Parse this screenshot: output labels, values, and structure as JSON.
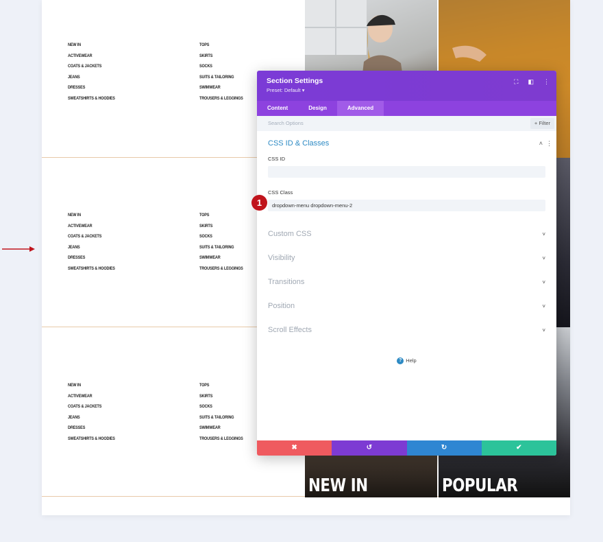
{
  "menu_left": [
    "NEW IN",
    "ACTIVEWEAR",
    "COATS & JACKETS",
    "JEANS",
    "DRESSES",
    "SWEATSHIRTS & HOODIES"
  ],
  "menu_right": [
    "TOPS",
    "SKIRTS",
    "SOCKS",
    "SUITS & TAILORING",
    "SWIMWEAR",
    "TROUSERS & LEGGINGS"
  ],
  "tiles": {
    "new_in": "NEW IN",
    "popular": "POPULAR"
  },
  "modal": {
    "title": "Section Settings",
    "preset": "Preset: Default ▾",
    "tabs": [
      "Content",
      "Design",
      "Advanced"
    ],
    "active_tab": "Advanced",
    "search_placeholder": "Search Options",
    "filter_label": "+ Filter",
    "group_title": "CSS ID & Classes",
    "css_id_label": "CSS ID",
    "css_id_value": "",
    "css_class_label": "CSS Class",
    "css_class_value": "dropdown-menu dropdown-menu-2",
    "badge_number": "1",
    "collapsed_groups": [
      "Custom CSS",
      "Visibility",
      "Transitions",
      "Position",
      "Scroll Effects"
    ],
    "help_label": "Help",
    "footer": {
      "cancel": "✖",
      "undo": "↺",
      "redo": "↻",
      "save": "✔"
    }
  },
  "colors": {
    "modal_header": "#7b3bd6",
    "tabs_bar": "#8d42df",
    "accent_blue": "#2d8ac4",
    "cancel": "#ef5a5f",
    "undo": "#7d3bd3",
    "redo": "#2f86d2",
    "save": "#2cc39a",
    "arrow": "#c0141c"
  }
}
